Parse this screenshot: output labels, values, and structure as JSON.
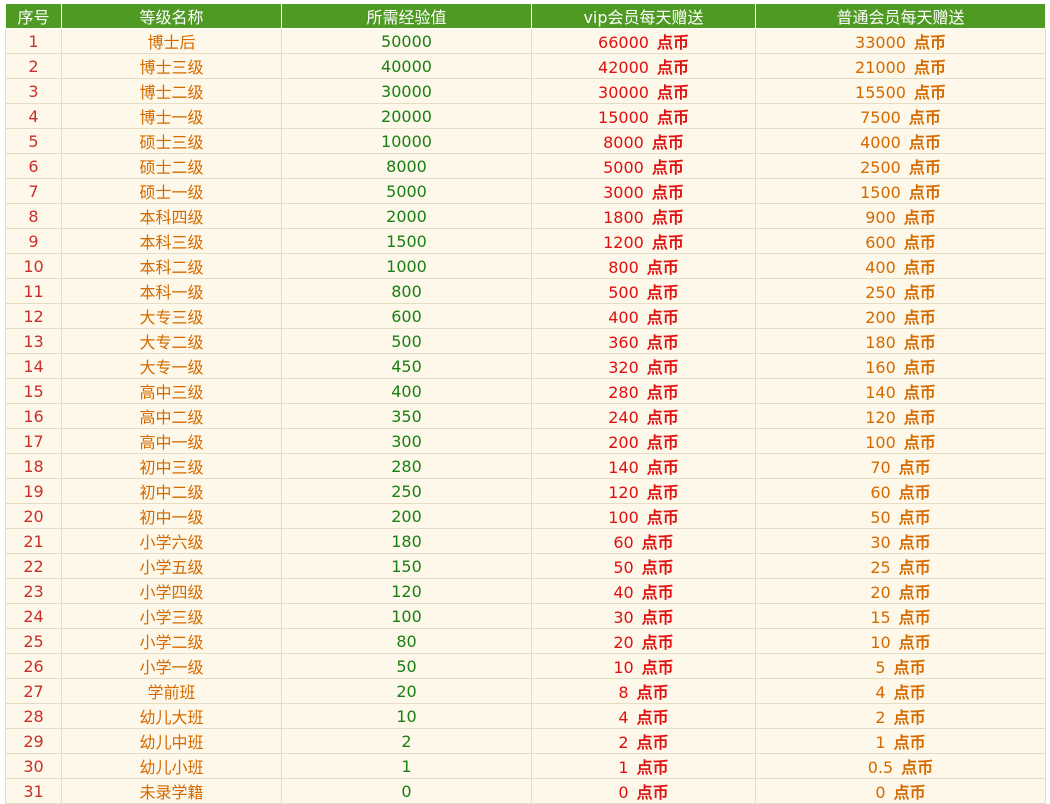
{
  "headers": [
    "序号",
    "等级名称",
    "所需经验值",
    "vip会员每天赠送",
    "普通会员每天赠送"
  ],
  "unit": "点币",
  "rows": [
    {
      "idx": "1",
      "name": "博士后",
      "exp": "50000",
      "vip": "66000",
      "normal": "33000"
    },
    {
      "idx": "2",
      "name": "博士三级",
      "exp": "40000",
      "vip": "42000",
      "normal": "21000"
    },
    {
      "idx": "3",
      "name": "博士二级",
      "exp": "30000",
      "vip": "30000",
      "normal": "15500"
    },
    {
      "idx": "4",
      "name": "博士一级",
      "exp": "20000",
      "vip": "15000",
      "normal": "7500"
    },
    {
      "idx": "5",
      "name": "硕士三级",
      "exp": "10000",
      "vip": "8000",
      "normal": "4000"
    },
    {
      "idx": "6",
      "name": "硕士二级",
      "exp": "8000",
      "vip": "5000",
      "normal": "2500"
    },
    {
      "idx": "7",
      "name": "硕士一级",
      "exp": "5000",
      "vip": "3000",
      "normal": "1500"
    },
    {
      "idx": "8",
      "name": "本科四级",
      "exp": "2000",
      "vip": "1800",
      "normal": "900"
    },
    {
      "idx": "9",
      "name": "本科三级",
      "exp": "1500",
      "vip": "1200",
      "normal": "600"
    },
    {
      "idx": "10",
      "name": "本科二级",
      "exp": "1000",
      "vip": "800",
      "normal": "400"
    },
    {
      "idx": "11",
      "name": "本科一级",
      "exp": "800",
      "vip": "500",
      "normal": "250"
    },
    {
      "idx": "12",
      "name": "大专三级",
      "exp": "600",
      "vip": "400",
      "normal": "200"
    },
    {
      "idx": "13",
      "name": "大专二级",
      "exp": "500",
      "vip": "360",
      "normal": "180"
    },
    {
      "idx": "14",
      "name": "大专一级",
      "exp": "450",
      "vip": "320",
      "normal": "160"
    },
    {
      "idx": "15",
      "name": "高中三级",
      "exp": "400",
      "vip": "280",
      "normal": "140"
    },
    {
      "idx": "16",
      "name": "高中二级",
      "exp": "350",
      "vip": "240",
      "normal": "120"
    },
    {
      "idx": "17",
      "name": "高中一级",
      "exp": "300",
      "vip": "200",
      "normal": "100"
    },
    {
      "idx": "18",
      "name": "初中三级",
      "exp": "280",
      "vip": "140",
      "normal": "70"
    },
    {
      "idx": "19",
      "name": "初中二级",
      "exp": "250",
      "vip": "120",
      "normal": "60"
    },
    {
      "idx": "20",
      "name": "初中一级",
      "exp": "200",
      "vip": "100",
      "normal": "50"
    },
    {
      "idx": "21",
      "name": "小学六级",
      "exp": "180",
      "vip": "60",
      "normal": "30"
    },
    {
      "idx": "22",
      "name": "小学五级",
      "exp": "150",
      "vip": "50",
      "normal": "25"
    },
    {
      "idx": "23",
      "name": "小学四级",
      "exp": "120",
      "vip": "40",
      "normal": "20"
    },
    {
      "idx": "24",
      "name": "小学三级",
      "exp": "100",
      "vip": "30",
      "normal": "15"
    },
    {
      "idx": "25",
      "name": "小学二级",
      "exp": "80",
      "vip": "20",
      "normal": "10"
    },
    {
      "idx": "26",
      "name": "小学一级",
      "exp": "50",
      "vip": "10",
      "normal": "5"
    },
    {
      "idx": "27",
      "name": "学前班",
      "exp": "20",
      "vip": "8",
      "normal": "4"
    },
    {
      "idx": "28",
      "name": "幼儿大班",
      "exp": "10",
      "vip": "4",
      "normal": "2"
    },
    {
      "idx": "29",
      "name": "幼儿中班",
      "exp": "2",
      "vip": "2",
      "normal": "1"
    },
    {
      "idx": "30",
      "name": "幼儿小班",
      "exp": "1",
      "vip": "1",
      "normal": "0.5"
    },
    {
      "idx": "31",
      "name": "未录学籍",
      "exp": "0",
      "vip": "0",
      "normal": "0"
    }
  ],
  "colors": {
    "header_bg": "#4f9a23",
    "row_bg": "#fdf8e9",
    "index": "#c9302c",
    "name": "#d46a00",
    "experience": "#1a7f13",
    "vip": "#e01010",
    "normal": "#d46a00"
  }
}
